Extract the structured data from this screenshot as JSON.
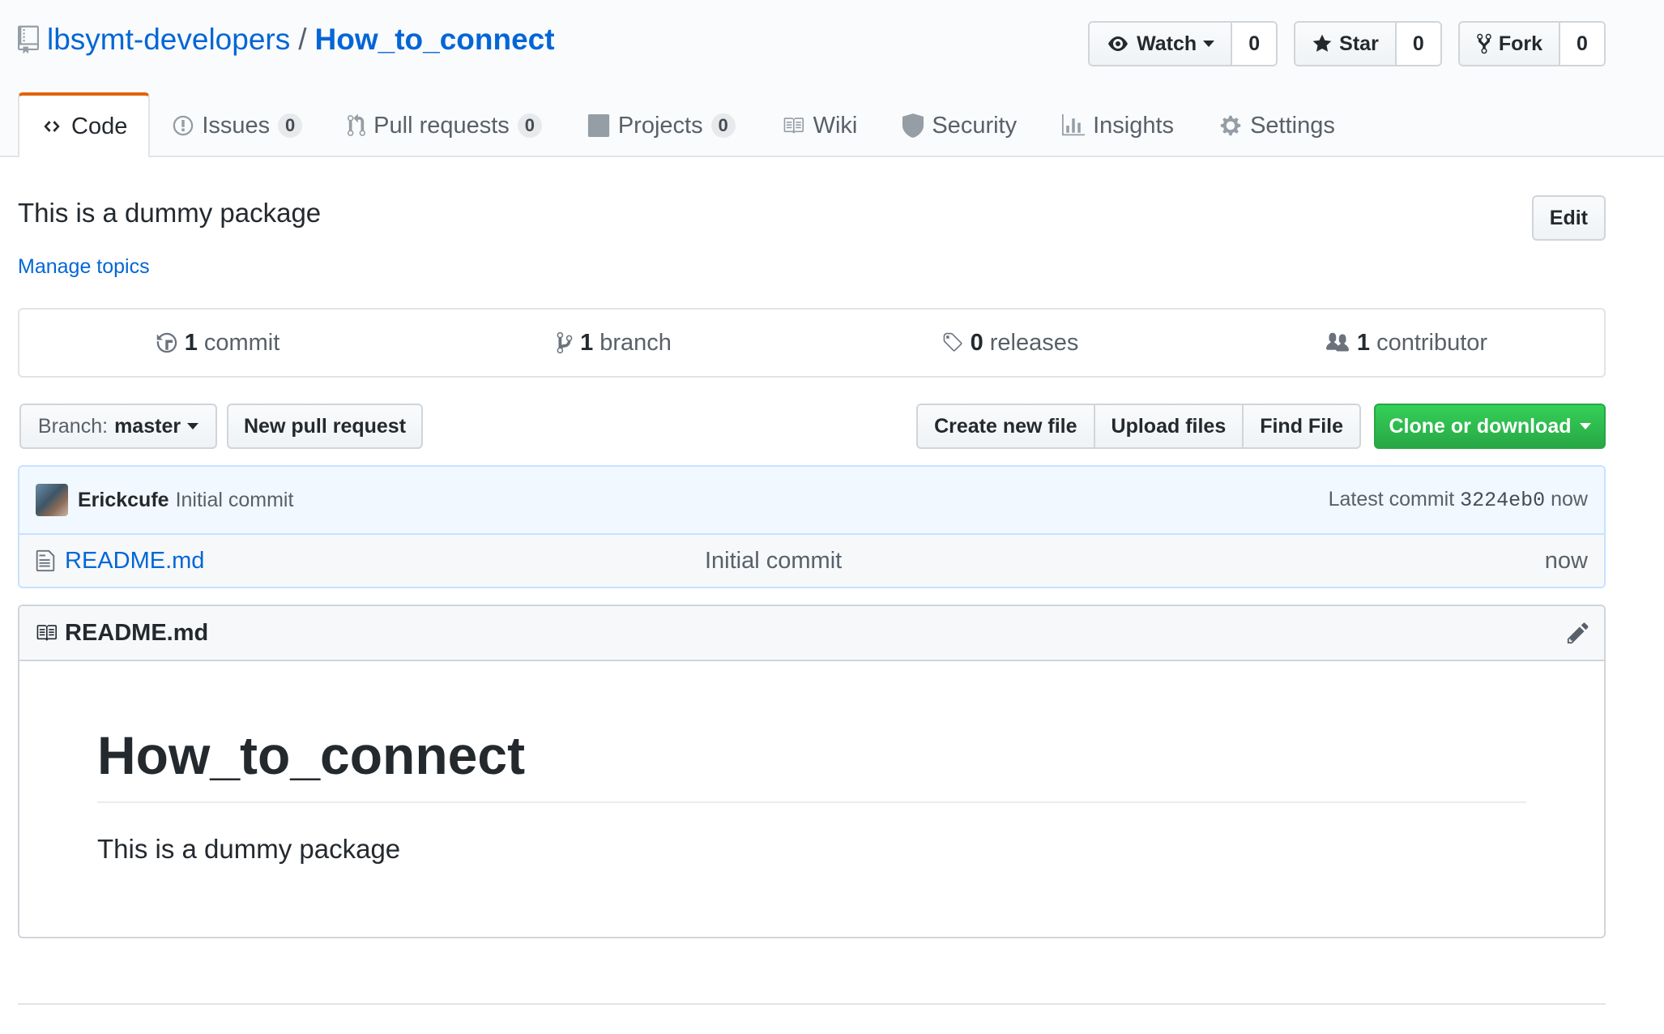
{
  "repo": {
    "owner": "lbsymt-developers",
    "separator": "/",
    "name": "How_to_connect"
  },
  "actions": {
    "watch": {
      "label": "Watch",
      "count": "0"
    },
    "star": {
      "label": "Star",
      "count": "0"
    },
    "fork": {
      "label": "Fork",
      "count": "0"
    }
  },
  "tabs": [
    {
      "label": "Code"
    },
    {
      "label": "Issues",
      "counter": "0"
    },
    {
      "label": "Pull requests",
      "counter": "0"
    },
    {
      "label": "Projects",
      "counter": "0"
    },
    {
      "label": "Wiki"
    },
    {
      "label": "Security"
    },
    {
      "label": "Insights"
    },
    {
      "label": "Settings"
    }
  ],
  "description": "This is a dummy package",
  "edit_label": "Edit",
  "manage_topics": "Manage topics",
  "summary": {
    "commits": {
      "num": "1",
      "label": "commit"
    },
    "branches": {
      "num": "1",
      "label": "branch"
    },
    "releases": {
      "num": "0",
      "label": "releases"
    },
    "contributors": {
      "num": "1",
      "label": "contributor"
    }
  },
  "filenav": {
    "branch_prefix": "Branch:",
    "branch_name": "master",
    "new_pr": "New pull request",
    "create_file": "Create new file",
    "upload_files": "Upload files",
    "find_file": "Find File",
    "clone": "Clone or download"
  },
  "commit": {
    "author": "Erickcufe",
    "message": "Initial commit",
    "latest_label": "Latest commit",
    "sha": "3224eb0",
    "age": "now"
  },
  "files": [
    {
      "name": "README.md",
      "message": "Initial commit",
      "age": "now"
    }
  ],
  "readme": {
    "filename": "README.md",
    "heading": "How_to_connect",
    "body": "This is a dummy package"
  },
  "colors": {
    "link": "#0366d6",
    "accent_tab": "#e36209",
    "clone_green": "#28a745"
  }
}
